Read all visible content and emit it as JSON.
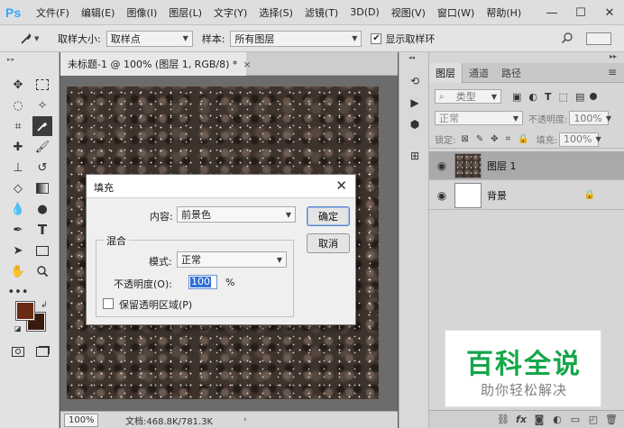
{
  "app": {
    "logo": "Ps"
  },
  "menu": [
    "文件(F)",
    "编辑(E)",
    "图像(I)",
    "图层(L)",
    "文字(Y)",
    "选择(S)",
    "滤镜(T)",
    "3D(D)",
    "视图(V)",
    "窗口(W)",
    "帮助(H)"
  ],
  "window_controls": {
    "minimize": "—",
    "maximize": "☐",
    "close": "✕"
  },
  "options": {
    "sample_size_label": "取样大小:",
    "sample_size_value": "取样点",
    "sample_label": "样本:",
    "sample_value": "所有图层",
    "show_ring_label": "显示取样环",
    "show_ring_checked": true
  },
  "document": {
    "tab_title": "未标题-1 @ 100% (图层 1, RGB/8) *",
    "tab_close": "×",
    "zoom": "100%",
    "doc_info": "文档:468.8K/781.3K"
  },
  "colors": {
    "foreground": "#6b2a12",
    "background": "#3a1a0c",
    "canvas": "#3d332c",
    "watermark_green": "#15a64a"
  },
  "layers_panel": {
    "tabs": [
      "图层",
      "通道",
      "路径"
    ],
    "filter_kind": "类型",
    "blend_mode": "正常",
    "opacity_label": "不透明度:",
    "opacity_value": "100%",
    "lock_label": "锁定:",
    "fill_label": "填充:",
    "fill_value": "100%",
    "layers": [
      {
        "name": "图层 1",
        "selected": true
      },
      {
        "name": "背景",
        "locked": true
      }
    ]
  },
  "dialog": {
    "title": "填充",
    "close": "✕",
    "content_label": "内容:",
    "content_value": "前景色",
    "ok": "确定",
    "cancel": "取消",
    "blend_group": "混合",
    "mode_label": "模式:",
    "mode_value": "正常",
    "opacity_label": "不透明度(O):",
    "opacity_value": "100",
    "opacity_unit": "%",
    "preserve_label": "保留透明区域(P)",
    "preserve_checked": false
  },
  "watermark": {
    "title": "百科全说",
    "subtitle": "助你轻松解决"
  }
}
